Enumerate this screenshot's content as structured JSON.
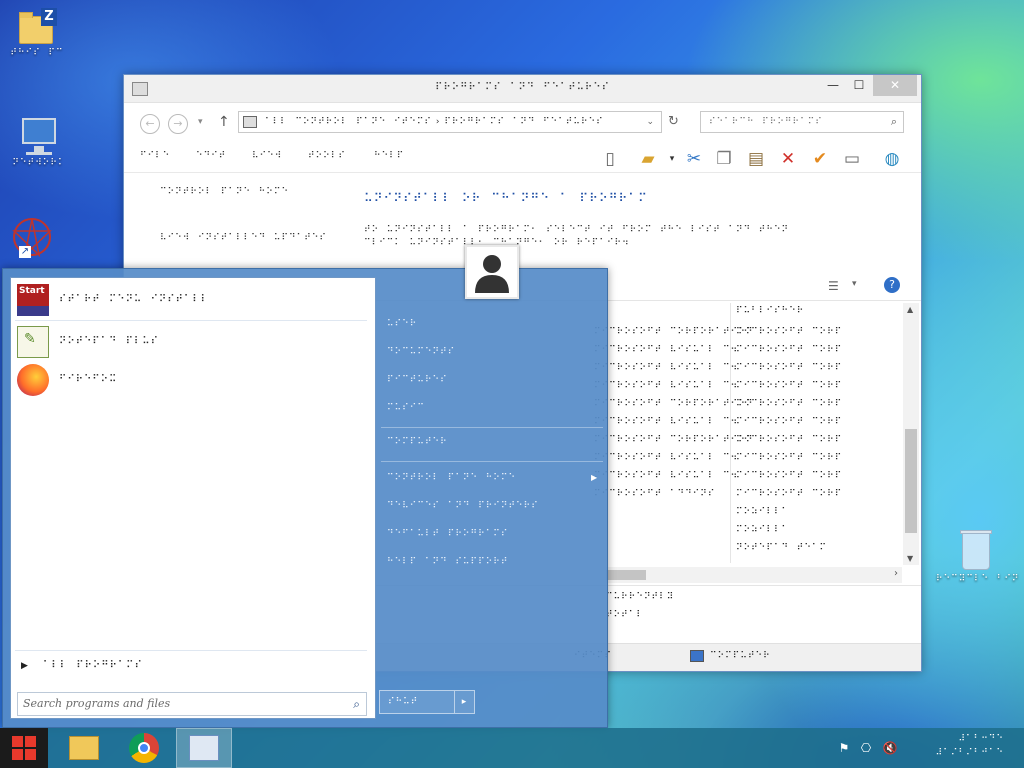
{
  "desktop": {
    "icons": [
      {
        "label": "⠞⠓⠊⠎⠀⠏⠉"
      },
      {
        "label": "⠝⠑⠞⠺⠕⠗⠅"
      },
      {
        "label": "⠗⠑⠉⠽⠉⠇⠑⠀⠃⠊⠝"
      }
    ],
    "folder_badge": "Z"
  },
  "explorer": {
    "title": "⠏⠗⠕⠛⠗⠁⠍⠎⠀⠁⠝⠙⠀⠋⠑⠁⠞⠥⠗⠑⠎",
    "address": "⠁⠇⠇⠀⠉⠕⠝⠞⠗⠕⠇⠀⠏⠁⠝⠑⠀⠊⠞⠑⠍⠎  ›  ⠏⠗⠕⠛⠗⠁⠍⠎⠀⠁⠝⠙⠀⠋⠑⠁⠞⠥⠗⠑⠎",
    "search_placeholder": "⠎⠑⠁⠗⠉⠓⠀⠏⠗⠕⠛⠗⠁⠍⠎",
    "menu": [
      "⠋⠊⠇⠑",
      "⠑⠙⠊⠞",
      "⠧⠊⠑⠺",
      "⠞⠕⠕⠇⠎",
      "⠓⠑⠇⠏"
    ],
    "props": {
      "label1": "⠉⠕⠝⠞⠗⠕⠇⠀⠏⠁⠝⠑⠀⠓⠕⠍⠑",
      "label2": "⠧⠊⠑⠺⠀⠊⠝⠎⠞⠁⠇⠇⠑⠙⠀⠥⠏⠙⠁⠞⠑⠎",
      "heading": "⠥⠝⠊⠝⠎⠞⠁⠇⠇⠀⠕⠗⠀⠉⠓⠁⠝⠛⠑⠀⠁⠀⠏⠗⠕⠛⠗⠁⠍",
      "desc_line1": "⠞⠕⠀⠥⠝⠊⠝⠎⠞⠁⠇⠇⠀⠁⠀⠏⠗⠕⠛⠗⠁⠍⠂⠀⠎⠑⠇⠑⠉⠞⠀⠊⠞⠀⠋⠗⠕⠍⠀⠞⠓⠑⠀⠇⠊⠎⠞⠀⠁⠝⠙⠀⠞⠓⠑⠝",
      "desc_line2": "⠉⠇⠊⠉⠅⠀⠥⠝⠊⠝⠎⠞⠁⠇⠇⠂⠀⠉⠓⠁⠝⠛⠑⠂⠀⠕⠗⠀⠗⠑⠏⠁⠊⠗⠲"
    },
    "list": {
      "header_col2": "⠏⠥⠃⠇⠊⠎⠓⠑⠗",
      "rows": [
        {
          "c1": "⠍⠊⠉⠗⠕⠎⠕⠋⠞⠀⠉⠕⠗⠏⠕⠗⠁⠞⠊⠕⠝",
          "c2": "⠍⠊⠉⠗⠕⠎⠕⠋⠞⠀⠉⠕⠗⠏"
        },
        {
          "c1": "⠍⠊⠉⠗⠕⠎⠕⠋⠞⠀⠧⠊⠎⠥⠁⠇⠀⠉⠲",
          "c2": "⠍⠊⠉⠗⠕⠎⠕⠋⠞⠀⠉⠕⠗⠏"
        },
        {
          "c1": "⠍⠊⠉⠗⠕⠎⠕⠋⠞⠀⠧⠊⠎⠥⠁⠇⠀⠉⠲",
          "c2": "⠍⠊⠉⠗⠕⠎⠕⠋⠞⠀⠉⠕⠗⠏"
        },
        {
          "c1": "⠍⠊⠉⠗⠕⠎⠕⠋⠞⠀⠧⠊⠎⠥⠁⠇⠀⠉⠲",
          "c2": "⠍⠊⠉⠗⠕⠎⠕⠋⠞⠀⠉⠕⠗⠏"
        },
        {
          "c1": "⠍⠊⠉⠗⠕⠎⠕⠋⠞⠀⠉⠕⠗⠏⠕⠗⠁⠞⠊⠕⠝",
          "c2": "⠍⠊⠉⠗⠕⠎⠕⠋⠞⠀⠉⠕⠗⠏"
        },
        {
          "c1": "⠍⠊⠉⠗⠕⠎⠕⠋⠞⠀⠧⠊⠎⠥⠁⠇⠀⠉⠲",
          "c2": "⠍⠊⠉⠗⠕⠎⠕⠋⠞⠀⠉⠕⠗⠏"
        },
        {
          "c1": "⠍⠊⠉⠗⠕⠎⠕⠋⠞⠀⠉⠕⠗⠏⠕⠗⠁⠞⠊⠕⠝",
          "c2": "⠍⠊⠉⠗⠕⠎⠕⠋⠞⠀⠉⠕⠗⠏"
        },
        {
          "c1": "⠍⠊⠉⠗⠕⠎⠕⠋⠞⠀⠧⠊⠎⠥⠁⠇⠀⠉⠲",
          "c2": "⠍⠊⠉⠗⠕⠎⠕⠋⠞⠀⠉⠕⠗⠏"
        },
        {
          "c1": "⠍⠊⠉⠗⠕⠎⠕⠋⠞⠀⠧⠊⠎⠥⠁⠇⠀⠉⠲",
          "c2": "⠍⠊⠉⠗⠕⠎⠕⠋⠞⠀⠉⠕⠗⠏"
        },
        {
          "c1": "⠍⠊⠉⠗⠕⠎⠕⠋⠞⠀⠁⠙⠙⠊⠝⠎",
          "c2": "⠍⠊⠉⠗⠕⠎⠕⠋⠞⠀⠉⠕⠗⠏"
        },
        {
          "c1": "",
          "c2": "⠍⠕⠵⠊⠇⠇⠁"
        },
        {
          "c1": "",
          "c2": "⠍⠕⠵⠊⠇⠇⠁"
        },
        {
          "c1": "",
          "c2": "⠝⠕⠞⠑⠏⠁⠙⠀⠞⠑⠁⠍"
        },
        {
          "c1": "",
          "c2": "⠉⠕⠍⠏⠥⠞⠑⠗"
        }
      ]
    },
    "details": {
      "line1": "⠉⠥⠗⠗⠑⠝⠞⠇⠽",
      "line2": "⠞⠕⠞⠁⠇"
    },
    "status": {
      "items": "⠊⠞⠑⠍⠎",
      "computer": "⠉⠕⠍⠏⠥⠞⠑⠗"
    }
  },
  "start_menu": {
    "programs": [
      {
        "label": "⠎⠞⠁⠗⠞⠀⠍⠑⠝⠥⠀⠊⠝⠎⠞⠁⠇⠇",
        "icon": "start-menu-app-icon",
        "icon_text": "Start"
      },
      {
        "label": "⠝⠕⠞⠑⠏⠁⠙⠀⠏⠇⠥⠎",
        "icon": "notepad-plus-icon"
      },
      {
        "label": "⠋⠊⠗⠑⠋⠕⠭",
        "icon": "firefox-icon"
      }
    ],
    "all_programs": "⠁⠇⠇⠀⠏⠗⠕⠛⠗⠁⠍⠎",
    "search_placeholder": "Search programs and files",
    "right": [
      "⠥⠎⠑⠗",
      "⠙⠕⠉⠥⠍⠑⠝⠞⠎",
      "⠏⠊⠉⠞⠥⠗⠑⠎",
      "⠍⠥⠎⠊⠉",
      "⠉⠕⠍⠏⠥⠞⠑⠗",
      "⠉⠕⠝⠞⠗⠕⠇⠀⠏⠁⠝⠑⠀⠓⠕⠍⠑",
      "⠙⠑⠧⠊⠉⠑⠎⠀⠁⠝⠙⠀⠏⠗⠊⠝⠞⠑⠗⠎",
      "⠙⠑⠋⠁⠥⠇⠞⠀⠏⠗⠕⠛⠗⠁⠍⠎",
      "⠓⠑⠇⠏⠀⠁⠝⠙⠀⠎⠥⠏⠏⠕⠗⠞"
    ],
    "shutdown": "⠎⠓⠥⠞"
  },
  "taskbar": {
    "clock_time": "⠼⠁⠃⠒⠙⠑",
    "clock_date": "⠼⠁⠌⠃⠌⠃⠚⠁⠑"
  },
  "colors": {
    "start_accent": "#568cc8",
    "taskbar": "#1e6e8c",
    "close": "#c7c7c7"
  }
}
